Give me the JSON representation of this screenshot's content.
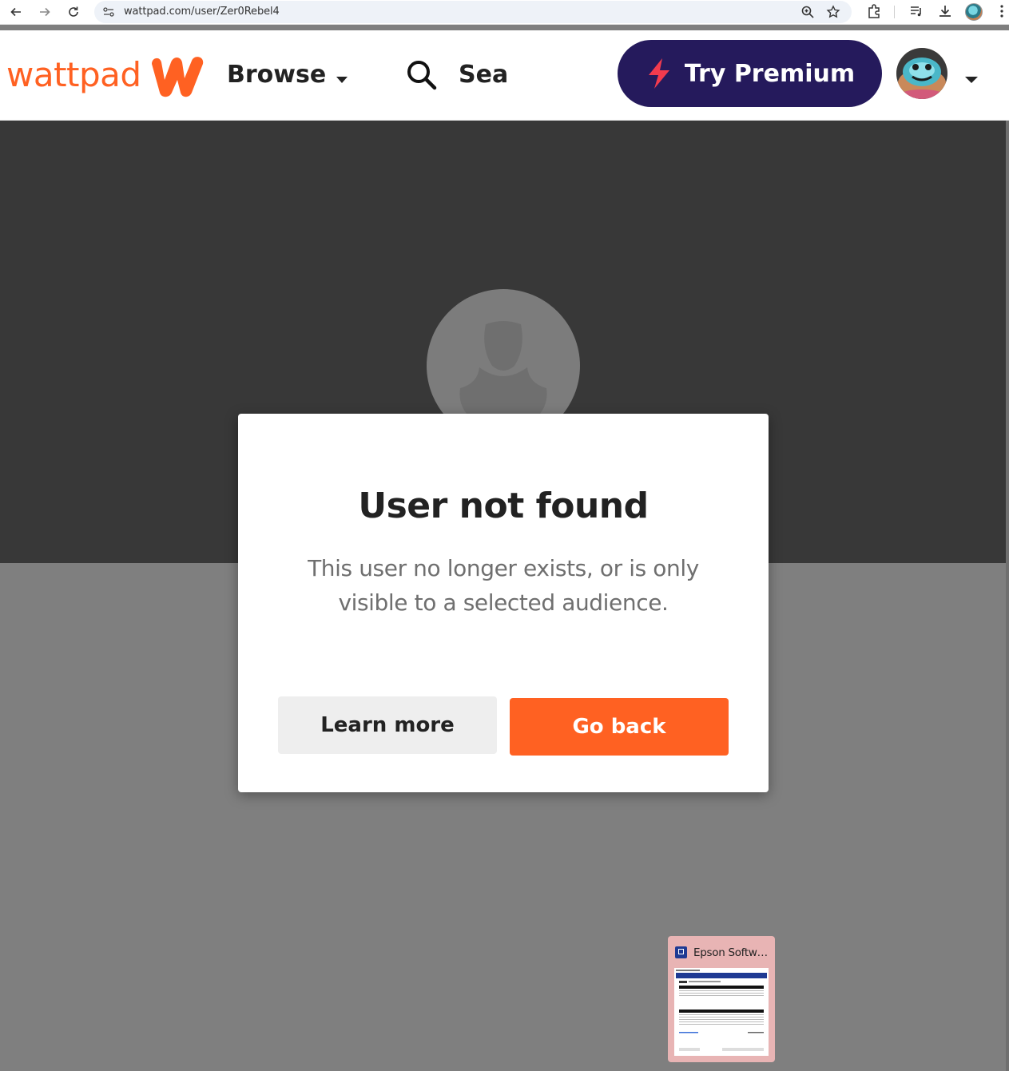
{
  "browser": {
    "url": "wattpad.com/user/Zer0Rebel4",
    "icons": [
      "back-arrow-icon",
      "forward-arrow-icon",
      "reload-icon",
      "site-settings-icon",
      "zoom-icon",
      "bookmark-star-icon",
      "extensions-icon",
      "media-controls-icon",
      "download-icon",
      "profile-icon",
      "menu-dots-icon"
    ]
  },
  "header": {
    "brand": "wattpad",
    "brand_color": "#ff6122",
    "browse_label": "Browse",
    "search_placeholder": "Sea",
    "premium_label": "Try Premium",
    "premium_bg": "#251a5c",
    "premium_icon": "lightning-bolt-icon"
  },
  "modal": {
    "title": "User not found",
    "message": "This user no longer exists, or is only visible to a selected audience.",
    "learn_more_label": "Learn more",
    "go_back_label": "Go back",
    "go_back_color": "#ff6122"
  },
  "taskbar_preview": {
    "title": "Epson Softwa..."
  }
}
